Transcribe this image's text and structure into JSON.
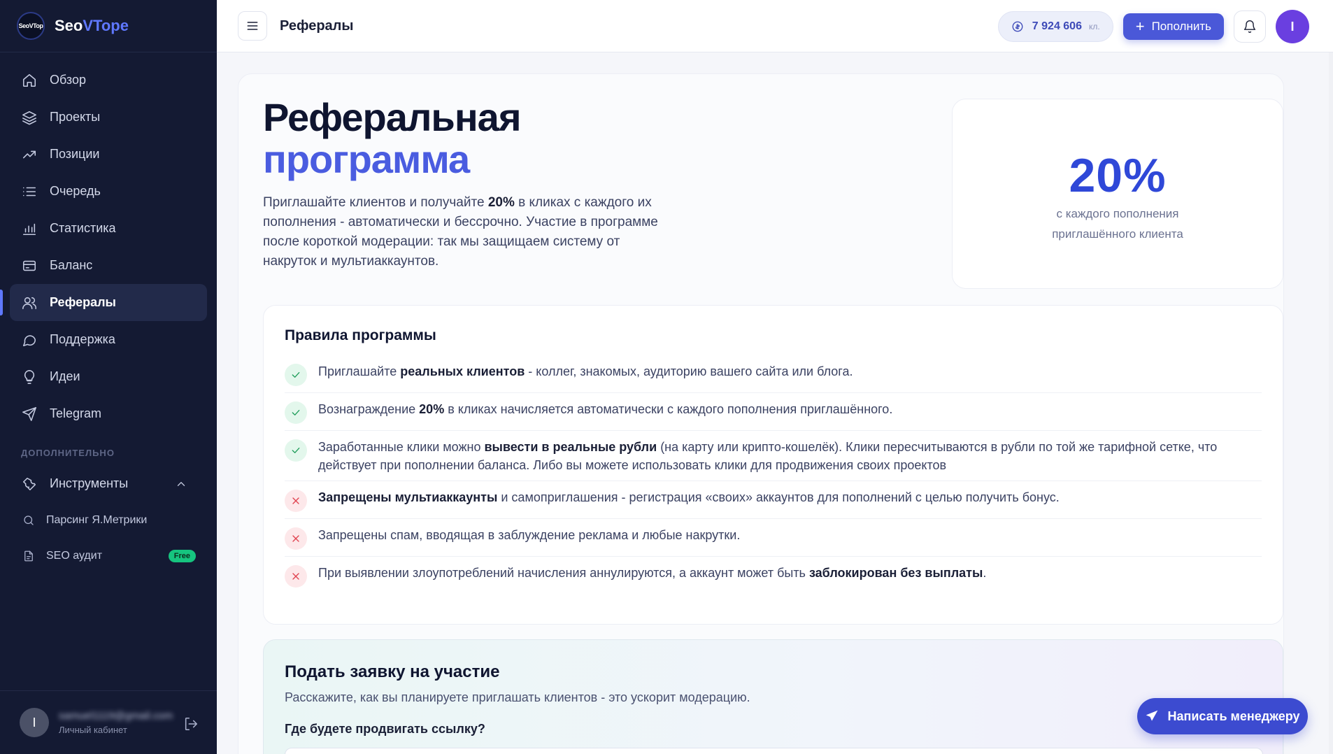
{
  "brand": {
    "logo_text": "SeoVTop",
    "name_part1": "Seo",
    "name_part2": "VTope"
  },
  "sidebar": {
    "items": [
      {
        "label": "Обзор",
        "icon": "home-icon"
      },
      {
        "label": "Проекты",
        "icon": "layers-icon"
      },
      {
        "label": "Позиции",
        "icon": "trending-icon"
      },
      {
        "label": "Очередь",
        "icon": "list-icon"
      },
      {
        "label": "Статистика",
        "icon": "bar-chart-icon"
      },
      {
        "label": "Баланс",
        "icon": "wallet-icon"
      },
      {
        "label": "Рефералы",
        "icon": "users-icon",
        "active": true
      },
      {
        "label": "Поддержка",
        "icon": "chat-icon"
      },
      {
        "label": "Идеи",
        "icon": "lightbulb-icon"
      },
      {
        "label": "Telegram",
        "icon": "telegram-icon"
      }
    ],
    "section_title": "ДОПОЛНИТЕЛЬНО",
    "tools": {
      "label": "Инструменты",
      "sub_items": [
        {
          "label": "Парсинг Я.Метрики",
          "icon": "search-icon"
        },
        {
          "label": "SEO аудит",
          "icon": "file-icon",
          "badge": "Free"
        }
      ]
    },
    "footer": {
      "email": "samuel1119@gmail.com",
      "subtitle": "Личный кабинет",
      "avatar_letter": "I"
    }
  },
  "topbar": {
    "title": "Рефералы",
    "balance": "7 924 606",
    "balance_unit": "кл.",
    "topup_label": "Пополнить",
    "avatar_letter": "I"
  },
  "hero": {
    "title_line1": "Реферальная",
    "title_line2": "программа",
    "desc_part1": "Приглашайте клиентов и получайте ",
    "desc_bold": "20%",
    "desc_part2": " в кликах с каждого их пополнения - автоматически и бессрочно. Участие в программе после короткой модерации: так мы защищаем систему от накруток и мультиаккаунтов."
  },
  "stat": {
    "value": "20%",
    "line1": "с каждого пополнения",
    "line2": "приглашённого клиента"
  },
  "rules": {
    "title": "Правила программы",
    "items": [
      {
        "type": "ok",
        "pre": "Приглашайте ",
        "bold": "реальных клиентов",
        "post": " - коллег, знакомых, аудиторию вашего сайта или блога."
      },
      {
        "type": "ok",
        "pre": "Вознаграждение ",
        "bold": "20%",
        "post": " в кликах начисляется автоматически с каждого пополнения приглашённого."
      },
      {
        "type": "ok",
        "pre": "Заработанные клики можно ",
        "bold": "вывести в реальные рубли",
        "post": " (на карту или крипто-кошелёк). Клики пересчитываются в рубли по той же тарифной сетке, что действует при пополнении баланса. Либо вы можете использовать клики для продвижения своих проектов"
      },
      {
        "type": "no",
        "pre": "",
        "bold": "Запрещены мультиаккаунты",
        "post": " и самоприглашения - регистрация «своих» аккаунтов для пополнений с целью получить бонус."
      },
      {
        "type": "no",
        "pre": "Запрещены спам, вводящая в заблуждение реклама и любые накрутки.",
        "bold": "",
        "post": ""
      },
      {
        "type": "no",
        "pre": "При выявлении злоупотреблений начисления аннулируются, а аккаунт может быть ",
        "bold": "заблокирован без выплаты",
        "post": "."
      }
    ]
  },
  "apply": {
    "title": "Подать заявку на участие",
    "subtitle": "Расскажите, как вы планируете приглашать клиентов - это ускорит модерацию.",
    "field_label": "Где будете продвигать ссылку?"
  },
  "fab": {
    "label": "Написать менеджеру"
  }
}
